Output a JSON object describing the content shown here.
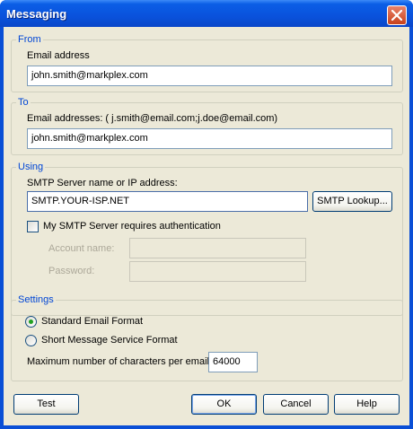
{
  "window": {
    "title": "Messaging"
  },
  "from": {
    "legend": "From",
    "label": "Email address",
    "value": "john.smith@markplex.com"
  },
  "to": {
    "legend": "To",
    "label": "Email addresses: ( j.smith@email.com;j.doe@email.com)",
    "value": "john.smith@markplex.com"
  },
  "using": {
    "legend": "Using",
    "server_label": "SMTP Server name or IP address:",
    "server_value": "SMTP.YOUR-ISP.NET",
    "lookup_button": "SMTP Lookup...",
    "auth_label": "My SMTP Server requires authentication",
    "auth_checked": false,
    "account_label": "Account name:",
    "account_value": "",
    "password_label": "Password:",
    "password_value": ""
  },
  "settings": {
    "legend": "Settings",
    "format_standard": "Standard Email Format",
    "format_sms": "Short Message Service Format",
    "selected_format": "Standard Email Format",
    "max_chars_label": "Maximum number of characters per email:",
    "max_chars_value": "64000"
  },
  "buttons": {
    "test": "Test",
    "ok": "OK",
    "cancel": "Cancel",
    "help": "Help"
  },
  "colors": {
    "titlebar": "#0a52dc",
    "client_bg": "#ece9d8",
    "legend_text": "#0046d5",
    "close_button": "#c8421c"
  }
}
